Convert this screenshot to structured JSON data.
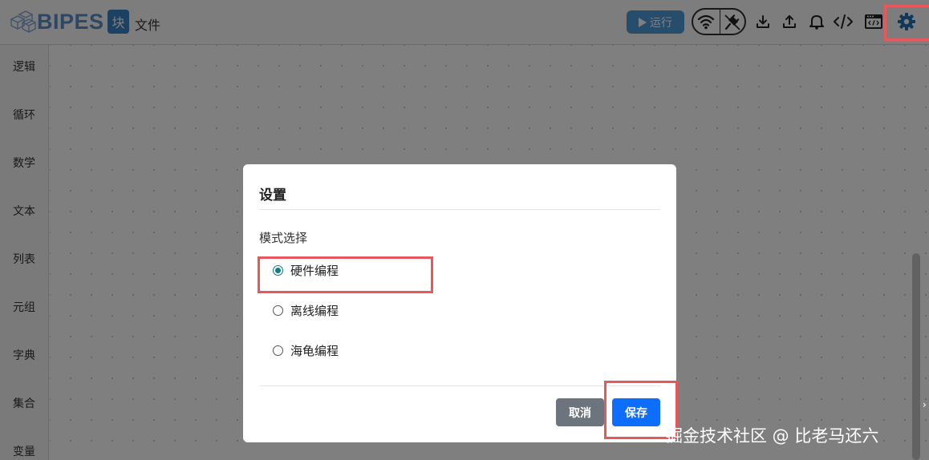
{
  "app": {
    "brand": "BIPES",
    "mode_badge": "块",
    "file_menu": "文件"
  },
  "toolbar": {
    "run_label": "运行",
    "icons": [
      "wifi-icon",
      "usb-plug-icon",
      "download-icon",
      "upload-icon",
      "bell-icon",
      "code-icon",
      "console-icon",
      "settings-gear-icon"
    ]
  },
  "sidebar": {
    "categories": [
      {
        "label": "逻辑"
      },
      {
        "label": "循环"
      },
      {
        "label": "数学"
      },
      {
        "label": "文本"
      },
      {
        "label": "列表"
      },
      {
        "label": "元组"
      },
      {
        "label": "字典"
      },
      {
        "label": "集合"
      },
      {
        "label": "变量"
      }
    ]
  },
  "dialog": {
    "title": "设置",
    "section_label": "模式选择",
    "options": [
      {
        "label": "硬件编程",
        "selected": true
      },
      {
        "label": "离线编程",
        "selected": false
      },
      {
        "label": "海龟编程",
        "selected": false
      }
    ],
    "cancel_label": "取消",
    "save_label": "保存"
  },
  "colors": {
    "brand": "#5a8fc9",
    "run_button": "#4d9bd8",
    "cancel_button": "#6c757d",
    "save_button": "#0d6efd",
    "radio_selected": "#0b7d8c",
    "highlight": "#e8575b"
  },
  "watermark": "掘金技术社区 @ 比老马还六"
}
